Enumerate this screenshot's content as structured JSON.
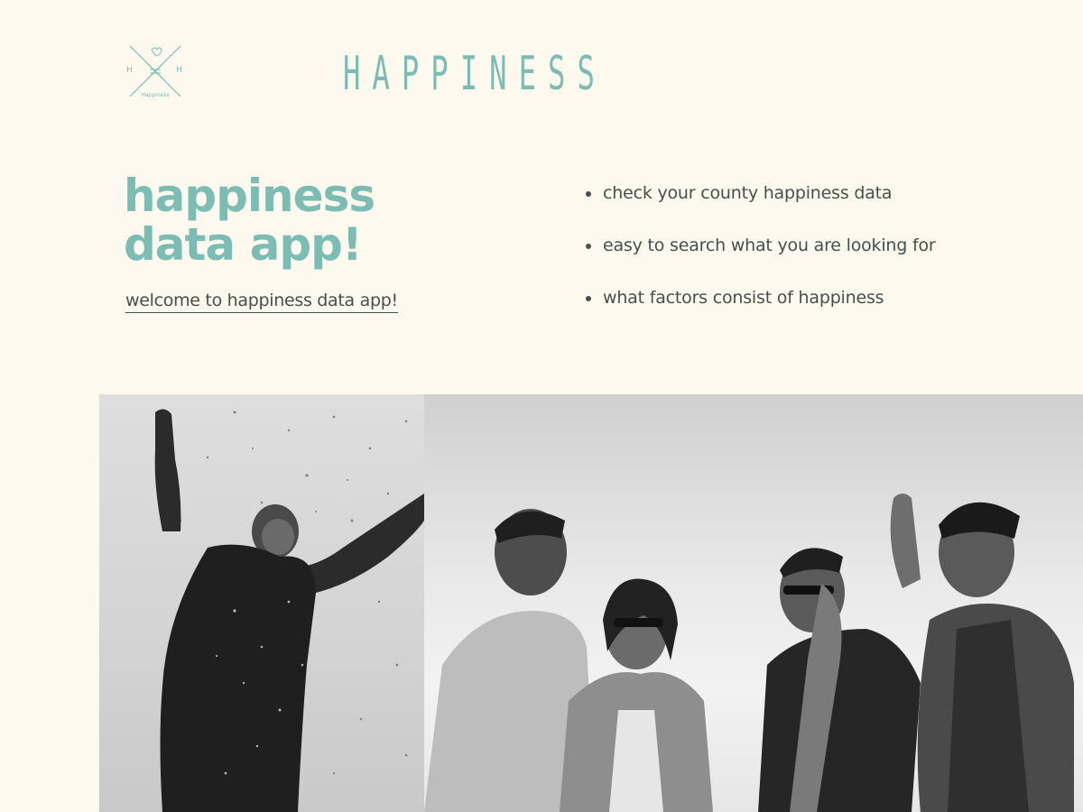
{
  "logo": {
    "left_letter": "H",
    "right_letter": "H",
    "caption": "Happiness",
    "icon": "hand-heart-icon",
    "accent_color": "#7bbdb3"
  },
  "brand": {
    "title": "HAPPINESS"
  },
  "hero": {
    "heading_line1": "happiness",
    "heading_line2": "data app!",
    "welcome_link": "welcome to happiness data app!"
  },
  "features": [
    "check your county happiness data",
    "easy to search what you are looking for",
    "what factors consist of happiness"
  ],
  "photos": {
    "left": "woman-celebrating-confetti-photo",
    "right": "group-of-friends-laughing-photo"
  },
  "colors": {
    "background": "#fdf9ee",
    "accent": "#7bbdb3",
    "text": "#44504c"
  }
}
